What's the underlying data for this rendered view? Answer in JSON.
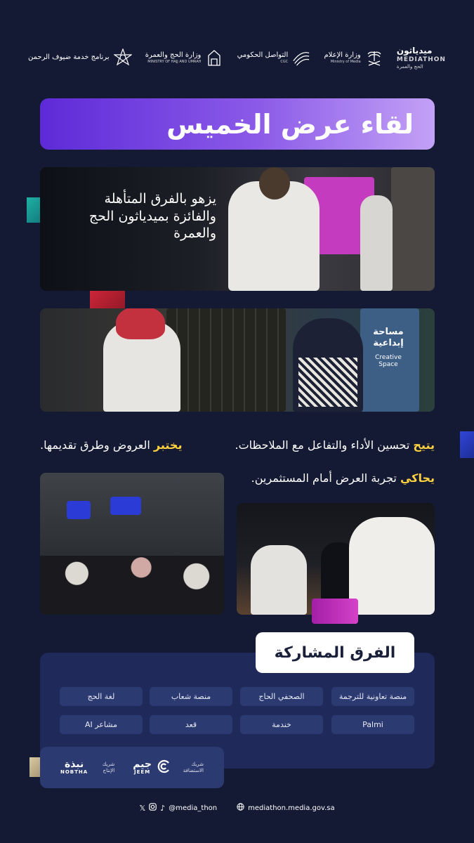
{
  "colors": {
    "background": "#141a34",
    "title_gradient_start": "#5e2ad8",
    "title_gradient_end": "#c3a1f6",
    "highlight": "#ffd23f",
    "panel": "#1f2a5a",
    "chip": "#2c3a72"
  },
  "header": {
    "logos": [
      {
        "name": "برنامج خدمة ضيوف الرحمن",
        "icon": "star-emblem-icon"
      },
      {
        "name": "وزارة الحج والعمرة",
        "sub": "MINISTRY OF HAJJ AND UMRAH",
        "icon": "hajj-ministry-icon"
      },
      {
        "name": "التواصل الحكومي",
        "sub": "CGC",
        "icon": "cgc-wave-icon"
      },
      {
        "name": "وزارة الإعلام",
        "sub": "Ministry of Media",
        "icon": "palm-swords-icon"
      },
      {
        "name": "ميدياثون",
        "sub": "MEDIATHON",
        "sub2": "الحج والعمرة",
        "icon": "mediathon-icon"
      }
    ]
  },
  "title": "لقاء عرض الخميس",
  "photo1_caption": "يزهو بالفرق المتأهلة والفائزة بميدياثون الحج والعمرة",
  "photo2_sign": {
    "ar": "مساحة إبداعية",
    "en": "Creative Space"
  },
  "features": {
    "line1": {
      "hl": "يتيح",
      "text": " تحسين الأداء والتفاعل مع الملاحظات."
    },
    "line2": {
      "hl": "يختبر",
      "text": " العروض وطرق تقديمها."
    },
    "line3": {
      "hl": "يحاكي",
      "text": " تجربة العرض أمام المستثمرين."
    }
  },
  "teams": {
    "title": "الفرق المشاركة",
    "items": [
      "منصة تعاونية للترجمة",
      "الصحفي الحاج",
      "منصة شعاب",
      "لغة الحج",
      "Palmi",
      "خندمة",
      "قعد",
      "مشاعر AI"
    ]
  },
  "sponsors": [
    {
      "name": "جيم",
      "latin": "JEEM",
      "tag": "شريك الاستضافة",
      "icon": "jeem-icon"
    },
    {
      "name": "نبذة",
      "latin": "NOBTHA",
      "tag": "شريك الإنتاج",
      "icon": "nobtha-icon"
    }
  ],
  "footer": {
    "handle": "@media_thon",
    "website": "mediathon.media.gov.sa"
  }
}
